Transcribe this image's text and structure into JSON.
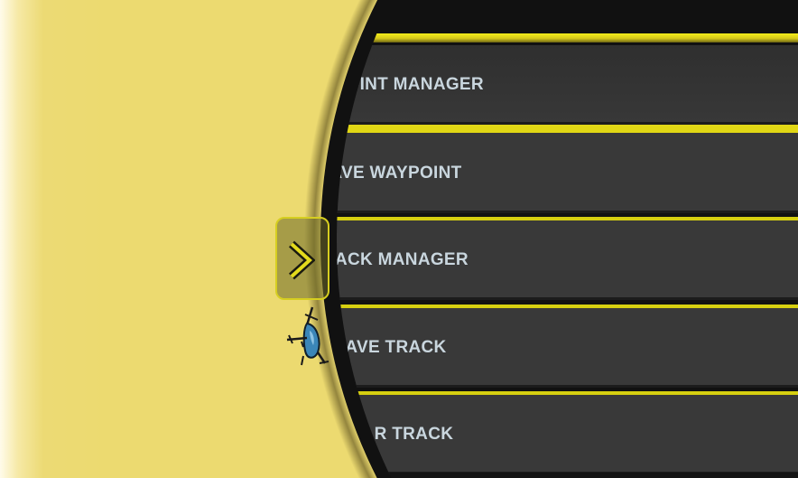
{
  "menu": {
    "items": [
      {
        "label": "WAYPOINT MANAGER"
      },
      {
        "label": "SAVE WAYPOINT"
      },
      {
        "label": "TRACK MANAGER"
      },
      {
        "label": "SAVE TRACK"
      },
      {
        "label": "CLEAR TRACK"
      }
    ]
  },
  "handle": {
    "icon": "chevron-right-icon"
  },
  "map": {
    "marker_icon": "helicopter-icon"
  },
  "colors": {
    "map_background": "#ecda70",
    "panel_background": "#111111",
    "button_background": "#393939",
    "accent_yellow": "#d6cf10",
    "button_text": "#c9d6de"
  }
}
